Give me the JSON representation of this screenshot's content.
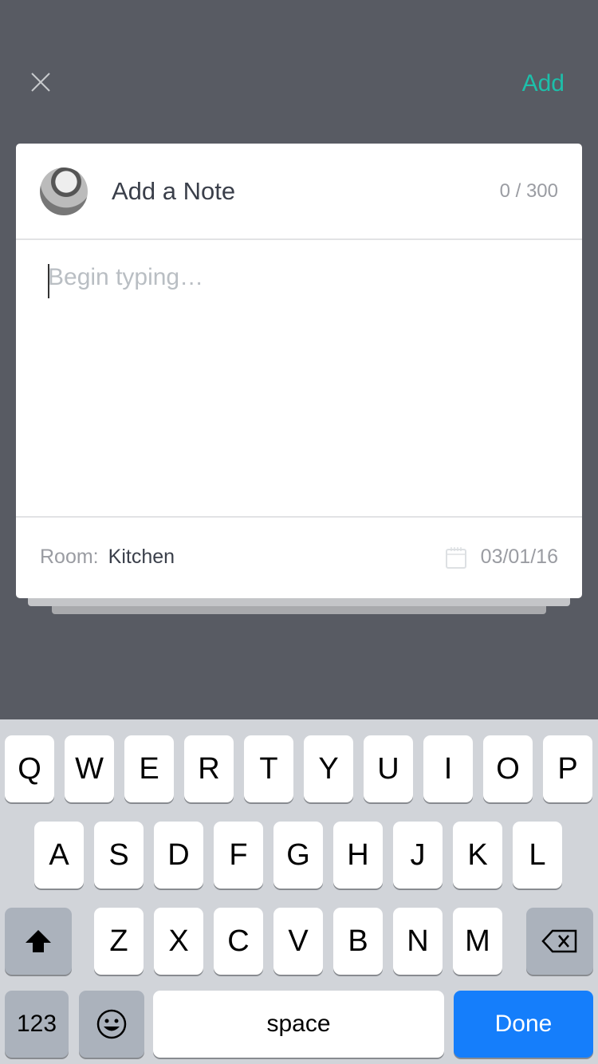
{
  "header": {
    "close_icon": "close-icon",
    "add_label": "Add",
    "accent": "#1dbfaa"
  },
  "note": {
    "title": "Add a Note",
    "count": "0 / 300",
    "placeholder": "Begin typing…",
    "room_label": "Room:",
    "room_value": "Kitchen",
    "date": "03/01/16"
  },
  "keyboard": {
    "row1": [
      "Q",
      "W",
      "E",
      "R",
      "T",
      "Y",
      "U",
      "I",
      "O",
      "P"
    ],
    "row2": [
      "A",
      "S",
      "D",
      "F",
      "G",
      "H",
      "J",
      "K",
      "L"
    ],
    "row3": [
      "Z",
      "X",
      "C",
      "V",
      "B",
      "N",
      "M"
    ],
    "numbers": "123",
    "space": "space",
    "done": "Done"
  }
}
